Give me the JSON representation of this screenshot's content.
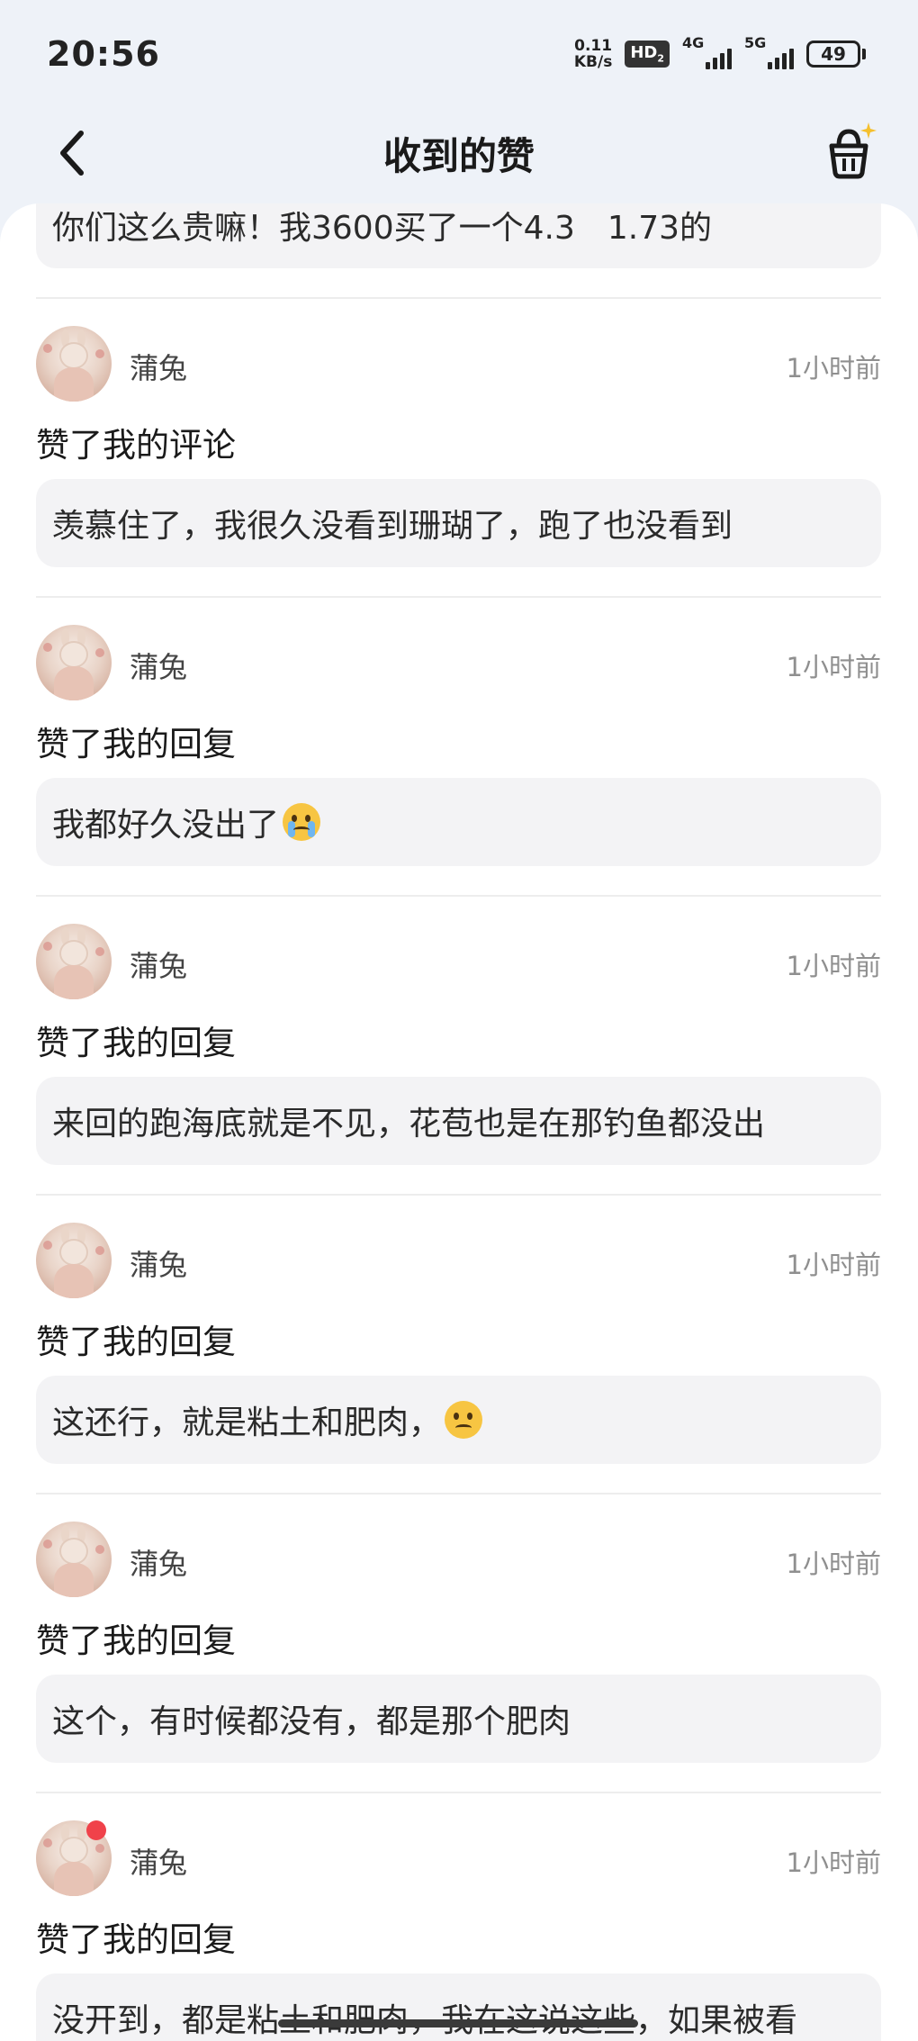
{
  "status_bar": {
    "time": "20:56",
    "net_speed_value": "0.11",
    "net_speed_unit": "KB/s",
    "hd": "HD",
    "hd_sub": "2",
    "signal1_label": "4G",
    "signal2_label": "5G",
    "battery": "49"
  },
  "nav": {
    "title": "收到的赞",
    "back_icon": "chevron-left-icon",
    "basket_icon": "basket-sparkle-icon"
  },
  "first_quote": "你们这么贵嘛！我3600买了一个4.3　1.73的",
  "items": [
    {
      "username": "蒲兔",
      "time": "1小时前",
      "action": "赞了我的评论",
      "quote": "羡慕住了，我很久没看到珊瑚了，跑了也没看到",
      "emoji": ""
    },
    {
      "username": "蒲兔",
      "time": "1小时前",
      "action": "赞了我的回复",
      "quote": "我都好久没出了",
      "emoji": "loudly-crying-face-icon"
    },
    {
      "username": "蒲兔",
      "time": "1小时前",
      "action": "赞了我的回复",
      "quote": "来回的跑海底就是不见，花苞也是在那钓鱼都没出",
      "emoji": ""
    },
    {
      "username": "蒲兔",
      "time": "1小时前",
      "action": "赞了我的回复",
      "quote": "这还行，就是粘土和肥肉，",
      "emoji": "slightly-frowning-face-icon"
    },
    {
      "username": "蒲兔",
      "time": "1小时前",
      "action": "赞了我的回复",
      "quote": "这个，有时候都没有，都是那个肥肉",
      "emoji": ""
    },
    {
      "username": "蒲兔",
      "time": "1小时前",
      "action": "赞了我的回复",
      "quote": "没开到，都是粘土和肥肉，我在这说这些，如果被看",
      "emoji": "",
      "unread": true
    }
  ],
  "colors": {
    "header_bg": "#eef2f8",
    "card_bg": "#ffffff",
    "quote_bg": "#f3f3f5",
    "time_text": "#8f8f8f",
    "unread_dot": "#f0424a",
    "sparkle": "#f5c02e"
  }
}
